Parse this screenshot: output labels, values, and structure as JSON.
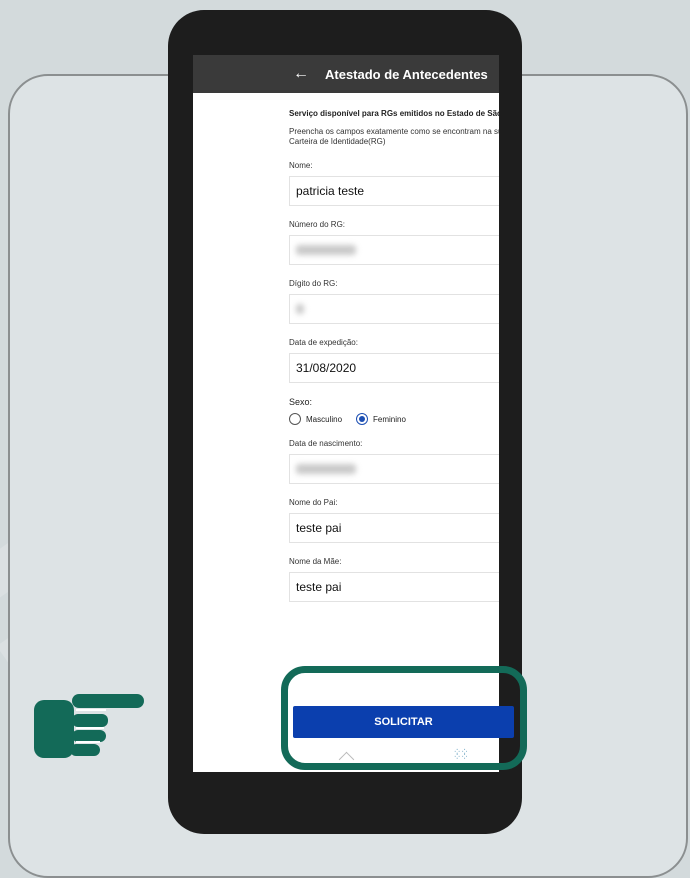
{
  "app": {
    "title": "Atestado de Antecedentes"
  },
  "form": {
    "notice_bold": "Serviço disponível para RGs emitidos no Estado de São Paulo.",
    "notice": "Preencha os campos exatamente como se encontram na sua Carteira de Identidade(RG)",
    "nome_label": "Nome:",
    "nome_value": "patricia teste",
    "rg_label": "Número do RG:",
    "digito_label": "Dígito do RG:",
    "expedicao_label": "Data de expedição:",
    "expedicao_value": "31/08/2020",
    "sexo_label": "Sexo:",
    "sexo_options": [
      "Masculino",
      "Feminino"
    ],
    "sexo_selected": "Feminino",
    "nascimento_label": "Data de nascimento:",
    "pai_label": "Nome do Pai:",
    "pai_value": "teste pai",
    "mae_label": "Nome da Mãe:",
    "mae_value": "teste pai",
    "submit_label": "SOLICITAR"
  },
  "colors": {
    "accent": "#0b3fae",
    "highlight": "#136a58",
    "appbar": "#3a3a3a"
  }
}
